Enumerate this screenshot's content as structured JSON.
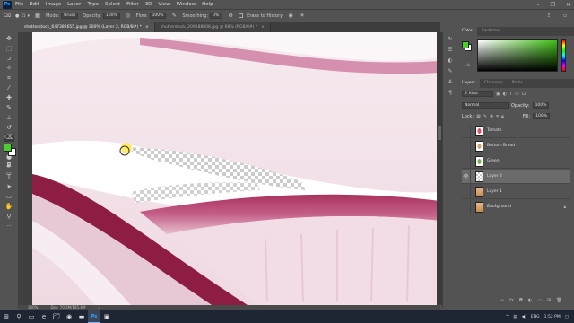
{
  "app": {
    "logo": "Ps"
  },
  "menu": [
    "File",
    "Edit",
    "Image",
    "Layer",
    "Type",
    "Select",
    "Filter",
    "3D",
    "View",
    "Window",
    "Help"
  ],
  "window_controls": [
    "–",
    "❐",
    "✕"
  ],
  "options_bar": {
    "brush_size": "21",
    "mode_label": "Mode:",
    "mode_value": "Brush",
    "opacity_label": "Opacity:",
    "opacity_value": "100%",
    "flow_label": "Flow:",
    "flow_value": "100%",
    "smoothing_label": "Smoothing:",
    "smoothing_value": "0%",
    "erase_history_label": "Erase to History"
  },
  "doc_tabs": [
    {
      "title": "shutterstock_647382655.jpg @ 300% (Layer 2, RGB/8#) *",
      "close": "×"
    },
    {
      "title": "shutterstock_209188808.jpg @ 66% (RGB/8#) *",
      "close": "×"
    }
  ],
  "status": {
    "zoom": "300%",
    "doc": "Doc: 70.3M/185.8M",
    "arrow": "›"
  },
  "right_panel": {
    "top_tabs": [
      "Color",
      "Swatches"
    ],
    "layer_tabs": [
      "Layers",
      "Channels",
      "Paths"
    ],
    "kind_label": "Kind",
    "blend_mode": "Normal",
    "opacity_label": "Opacity:",
    "opacity_value": "100%",
    "lock_label": "Lock:",
    "fill_label": "Fill:",
    "fill_value": "100%",
    "layers": [
      {
        "name": "Tomato",
        "thumb": "red",
        "selected": false
      },
      {
        "name": "Bottom Bread",
        "thumb": "brd",
        "selected": false
      },
      {
        "name": "Green",
        "thumb": "grn",
        "selected": false
      },
      {
        "name": "Layer 2",
        "thumb": "ck",
        "selected": true
      },
      {
        "name": "Layer 1",
        "thumb": "img",
        "selected": false
      },
      {
        "name": "Background",
        "thumb": "img",
        "selected": false
      }
    ]
  },
  "colors": {
    "foreground": "#4ccf2a",
    "background": "#ffffff",
    "picker_hue": "#3dbf12"
  },
  "taskbar": {
    "clock": "1:52 PM",
    "lang": "ENG"
  }
}
